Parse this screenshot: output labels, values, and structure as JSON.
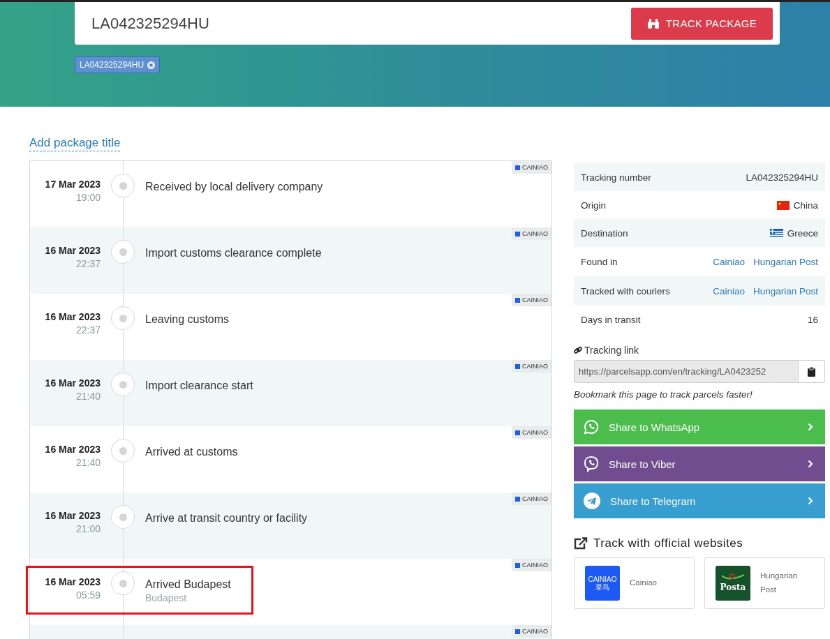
{
  "search": {
    "value": "LA042325294HU",
    "button": "TRACK PACKAGE"
  },
  "tags": [
    {
      "label": "LA042325294HU"
    }
  ],
  "title_link": "Add package title",
  "events": [
    {
      "date": "17 Mar 2023",
      "time": "19:00",
      "status": "Received by local delivery company",
      "courier": "CAINIAO",
      "highlighted": false
    },
    {
      "date": "16 Mar 2023",
      "time": "22:37",
      "status": "Import customs clearance complete",
      "courier": "CAINIAO",
      "highlighted": false
    },
    {
      "date": "16 Mar 2023",
      "time": "22:37",
      "status": "Leaving customs",
      "courier": "CAINIAO",
      "highlighted": false
    },
    {
      "date": "16 Mar 2023",
      "time": "21:40",
      "status": "Import clearance start",
      "courier": "CAINIAO",
      "highlighted": false
    },
    {
      "date": "16 Mar 2023",
      "time": "21:40",
      "status": "Arrived at customs",
      "courier": "CAINIAO",
      "highlighted": false
    },
    {
      "date": "16 Mar 2023",
      "time": "21:00",
      "status": "Arrive at transit country or facility",
      "courier": "CAINIAO",
      "highlighted": false
    },
    {
      "date": "16 Mar 2023",
      "time": "05:59",
      "status": "Arrived Budapest",
      "location": "Budapest",
      "courier": "CAINIAO",
      "highlighted": true
    },
    {
      "courier": "CAINIAO",
      "highlighted": false
    }
  ],
  "info": [
    {
      "label": "Tracking number",
      "kind": "text",
      "value": "LA042325294HU"
    },
    {
      "label": "Origin",
      "kind": "china_flag",
      "value": "China"
    },
    {
      "label": "Destination",
      "kind": "greece_flag",
      "value": "Greece"
    },
    {
      "label": "Found in",
      "kind": "links",
      "links": [
        "Cainiao",
        "Hungarian Post"
      ]
    },
    {
      "label": "Tracked with couriers",
      "kind": "links",
      "links": [
        "Cainiao",
        "Hungarian Post"
      ]
    },
    {
      "label": "Days in transit",
      "kind": "text",
      "value": "16"
    }
  ],
  "tracking_link": {
    "label": "Tracking link",
    "value": "https://parcelsapp.com/en/tracking/LA0423252",
    "note": "Bookmark this page to track parcels faster!"
  },
  "share": [
    {
      "kind": "whatsapp",
      "label": "Share to WhatsApp",
      "color": "#4bbd4c"
    },
    {
      "kind": "viber",
      "label": "Share to Viber",
      "color": "#714c8e"
    },
    {
      "kind": "telegram",
      "label": "Share to Telegram",
      "color": "#389dcf"
    }
  ],
  "official": {
    "heading": "Track with official websites",
    "sites": [
      {
        "kind": "cainiao",
        "name": "Cainiao",
        "logo_text": "CAINIAO 菜鸟"
      },
      {
        "kind": "posta",
        "name": "Hungarian Post",
        "logo_text": "Posta"
      }
    ]
  }
}
